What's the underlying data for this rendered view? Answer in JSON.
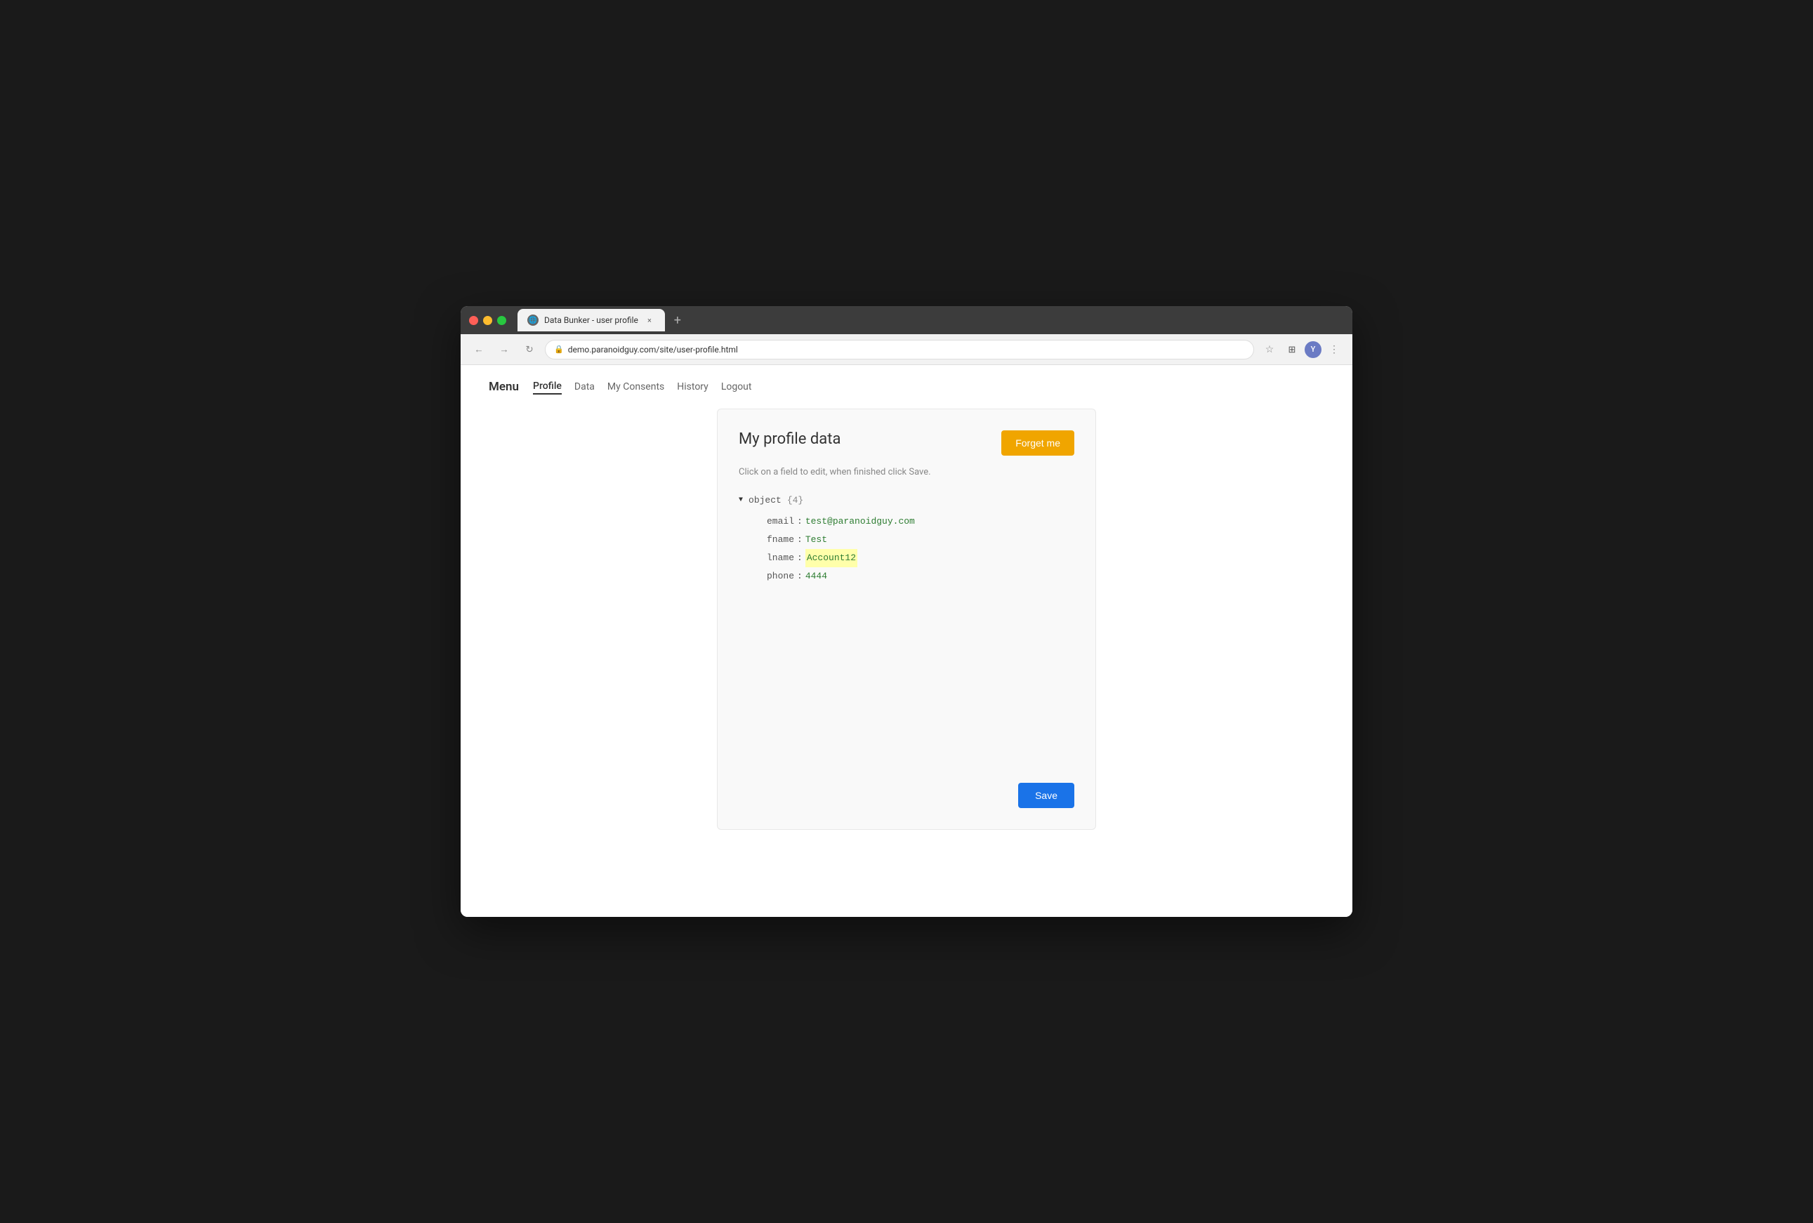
{
  "browser": {
    "tab_title": "Data Bunker - user profile",
    "tab_close": "×",
    "tab_add": "+",
    "address": "demo.paranoidguy.com/site/user-profile.html",
    "profile_initial": "Y"
  },
  "nav": {
    "back_icon": "←",
    "forward_icon": "→",
    "refresh_icon": "↻",
    "star_icon": "☆",
    "more_icon": "⋮"
  },
  "menu": {
    "label": "Menu",
    "items": [
      {
        "id": "profile",
        "label": "Profile",
        "active": true
      },
      {
        "id": "data",
        "label": "Data",
        "active": false
      },
      {
        "id": "my-consents",
        "label": "My Consents",
        "active": false
      },
      {
        "id": "history",
        "label": "History",
        "active": false
      },
      {
        "id": "logout",
        "label": "Logout",
        "active": false
      }
    ]
  },
  "card": {
    "title": "My profile data",
    "forget_button": "Forget me",
    "instruction": "Click on a field to edit, when finished click Save.",
    "object_label": "object",
    "object_count": "{4}",
    "fields": [
      {
        "key": "email",
        "value": "test@paranoidguy.com",
        "type": "email"
      },
      {
        "key": "fname",
        "value": "Test",
        "type": "string"
      },
      {
        "key": "lname",
        "value": "Account12",
        "type": "highlighted"
      },
      {
        "key": "phone",
        "value": "4444",
        "type": "number"
      }
    ],
    "save_button": "Save"
  }
}
